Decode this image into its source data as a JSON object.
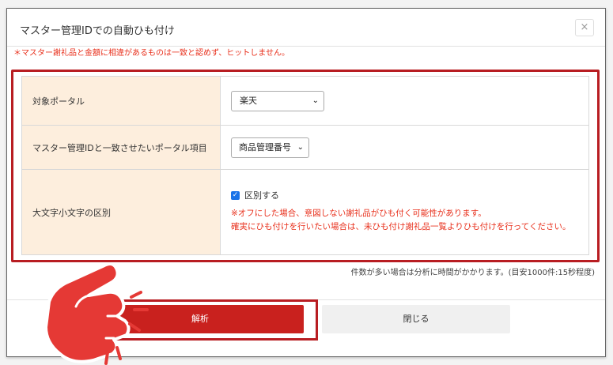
{
  "dialog": {
    "title": "マスター管理IDでの自動ひも付け",
    "close_glyph": "×",
    "notice": "＊マスター謝礼品と金額に相違があるものは一致と認めず、ヒットしません。"
  },
  "settings": {
    "rows": [
      {
        "label": "対象ポータル",
        "value": "楽天"
      },
      {
        "label": "マスター管理IDと一致させたいポータル項目",
        "value": "商品管理番号"
      },
      {
        "label": "大文字小文字の区別",
        "checkbox_label": "区別する",
        "checked": true,
        "warning_line1": "※オフにした場合、意図しない謝礼品がひも付く可能性があります。",
        "warning_line2": "確実にひも付けを行いたい場合は、未ひも付け謝礼品一覧よりひも付けを行ってください。"
      }
    ],
    "chevron_glyph": "⌄"
  },
  "hint": "件数が多い場合は分析に時間がかかります。(目安1000件:15秒程度)",
  "buttons": {
    "analyze": "解析",
    "close": "閉じる"
  },
  "colors": {
    "accent_red": "#c9211e",
    "highlight_border": "#b81d22",
    "label_bg": "#fdeedd",
    "checkbox_blue": "#1a73e8"
  },
  "icons": {
    "pointer": "pointing-hand-icon",
    "close": "close-icon",
    "chevron": "chevron-down-icon",
    "check": "check-icon"
  }
}
